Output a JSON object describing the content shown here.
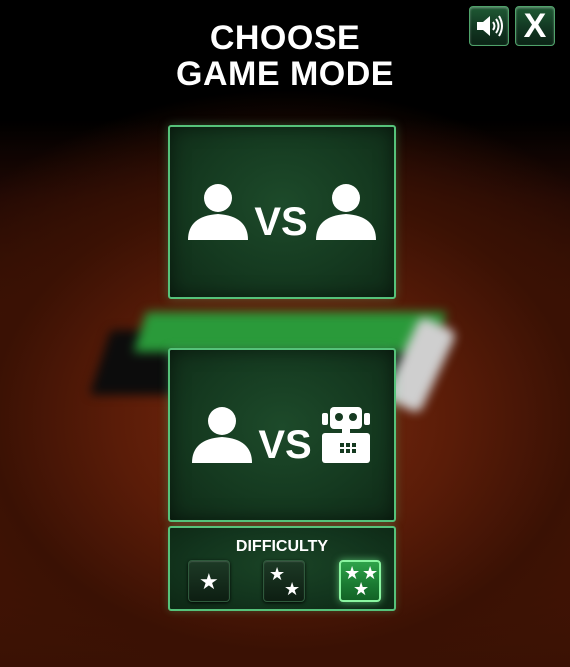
{
  "title": {
    "line1": "CHOOSE",
    "line2": "GAME MODE"
  },
  "top_buttons": {
    "sound_icon": "speaker-icon",
    "close_label": "X"
  },
  "modes": [
    {
      "id": "player-vs-player",
      "left_icon": "person-icon",
      "vs_label": "VS",
      "right_icon": "person-icon"
    },
    {
      "id": "player-vs-computer",
      "left_icon": "person-icon",
      "vs_label": "VS",
      "right_icon": "robot-icon"
    }
  ],
  "difficulty": {
    "label": "DIFFICULTY",
    "levels": [
      {
        "id": "easy",
        "stars": 1,
        "selected": false
      },
      {
        "id": "medium",
        "stars": 2,
        "selected": false
      },
      {
        "id": "hard",
        "stars": 3,
        "selected": true
      }
    ]
  },
  "colors": {
    "accent_green": "#56c27a",
    "selected_green": "#2ea34a",
    "background_wood": "#5a1c08"
  }
}
